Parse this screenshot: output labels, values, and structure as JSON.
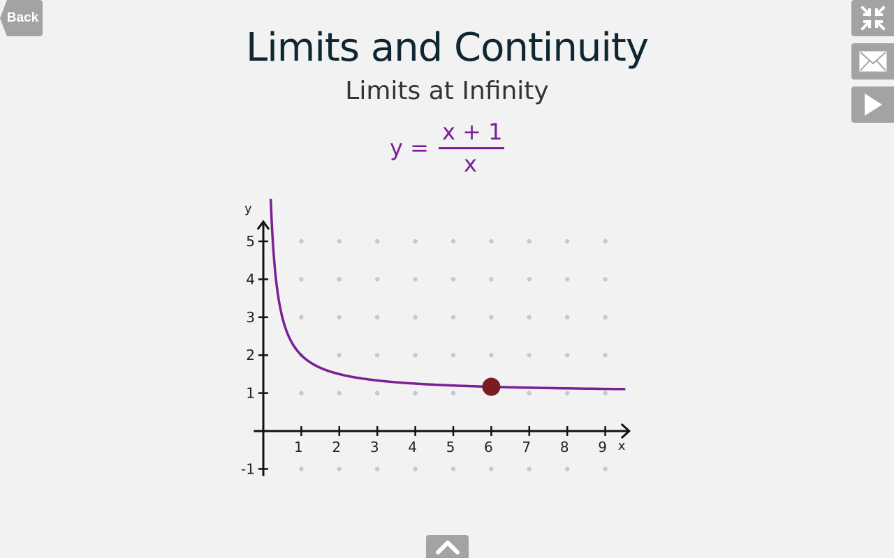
{
  "nav": {
    "back_label": "Back"
  },
  "toolbar": {
    "collapse_icon": "collapse-arrows-icon",
    "mail_icon": "envelope-icon",
    "play_icon": "play-icon",
    "bottom_toggle_icon": "chevron-up-icon"
  },
  "lesson": {
    "title": "Limits and Continuity",
    "subtitle": "Limits at Infinity"
  },
  "formula": {
    "lhs": "y =",
    "numerator": "x + 1",
    "denominator": "x"
  },
  "colors": {
    "curve": "#7a1f96",
    "point": "#7a1c22",
    "buttons": "#a3a3a3",
    "title": "#0f2733"
  },
  "chart_data": {
    "type": "line",
    "function": "y = (x + 1) / x",
    "xlabel": "x",
    "ylabel": "y",
    "xlim": [
      0,
      9.5
    ],
    "ylim": [
      -1,
      5.5
    ],
    "x_ticks": [
      "1",
      "2",
      "3",
      "4",
      "5",
      "6",
      "7",
      "8",
      "9"
    ],
    "y_ticks": [
      "-1",
      "1",
      "2",
      "3",
      "4",
      "5"
    ],
    "grid": "dots",
    "highlight_point": {
      "x": 6,
      "y": 1.1667
    }
  }
}
